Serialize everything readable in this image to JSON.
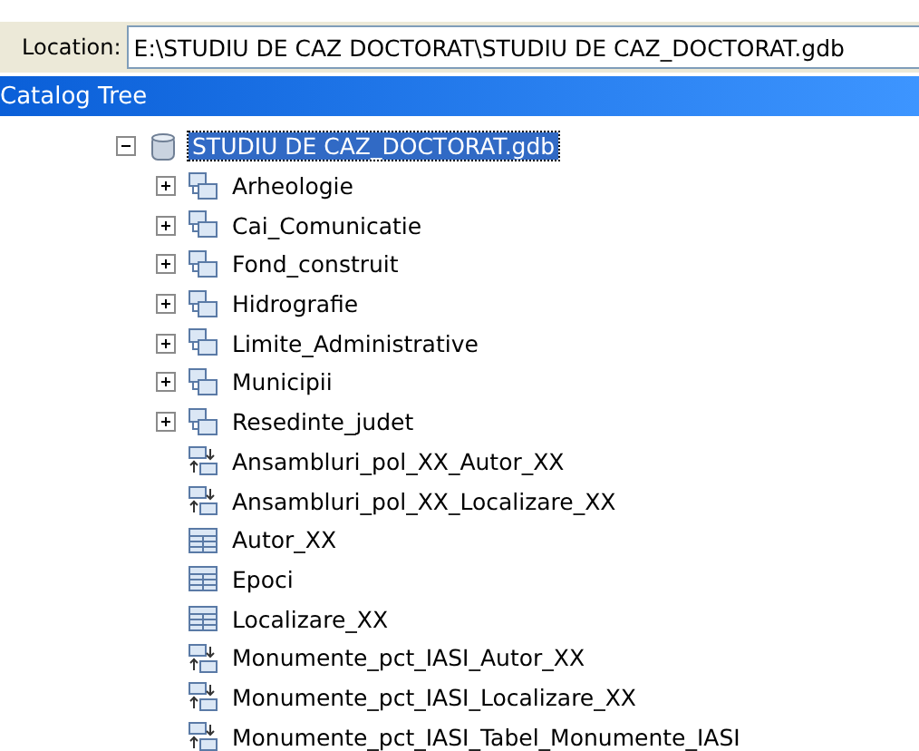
{
  "toolbar": {
    "label": "Location:",
    "value": "E:\\STUDIU DE CAZ DOCTORAT\\STUDIU DE CAZ_DOCTORAT.gdb"
  },
  "panel": {
    "title": "Catalog Tree"
  },
  "tree": [
    {
      "label": "STUDIU DE CAZ_DOCTORAT.gdb",
      "kind": "geodatabase",
      "expanded": true,
      "selected": true,
      "children": [
        {
          "label": "Arheologie",
          "kind": "dataset",
          "expanded": false,
          "selected": false
        },
        {
          "label": "Cai_Comunicatie",
          "kind": "dataset",
          "expanded": false,
          "selected": false
        },
        {
          "label": "Fond_construit",
          "kind": "dataset",
          "expanded": false,
          "selected": false
        },
        {
          "label": "Hidrografie",
          "kind": "dataset",
          "expanded": false,
          "selected": false
        },
        {
          "label": "Limite_Administrative",
          "kind": "dataset",
          "expanded": false,
          "selected": false
        },
        {
          "label": "Municipii",
          "kind": "dataset",
          "expanded": false,
          "selected": false
        },
        {
          "label": "Resedinte_judet",
          "kind": "dataset",
          "expanded": false,
          "selected": false
        },
        {
          "label": "Ansambluri_pol_XX_Autor_XX",
          "kind": "relationship",
          "selected": false
        },
        {
          "label": "Ansambluri_pol_XX_Localizare_XX",
          "kind": "relationship",
          "selected": false
        },
        {
          "label": "Autor_XX",
          "kind": "table",
          "selected": false
        },
        {
          "label": "Epoci",
          "kind": "table",
          "selected": false
        },
        {
          "label": "Localizare_XX",
          "kind": "table",
          "selected": false
        },
        {
          "label": "Monumente_pct_IASI_Autor_XX",
          "kind": "relationship",
          "selected": false
        },
        {
          "label": "Monumente_pct_IASI_Localizare_XX",
          "kind": "relationship",
          "selected": false
        },
        {
          "label": "Monumente_pct_IASI_Tabel_Monumente_IASI",
          "kind": "relationship",
          "selected": false
        }
      ]
    }
  ]
}
